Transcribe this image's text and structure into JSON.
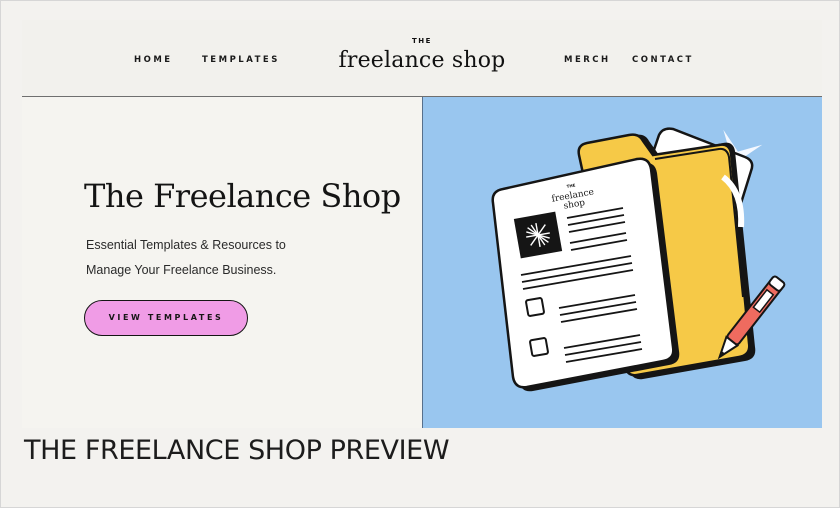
{
  "nav": {
    "home": "HOME",
    "templates": "TEMPLATES",
    "merch": "MERCH",
    "contact": "CONTACT"
  },
  "logo": {
    "small": "THE",
    "big": "freelance shop"
  },
  "hero": {
    "title": "The Freelance Shop",
    "subtitle_line1": "Essential Templates & Resources to",
    "subtitle_line2": "Manage Your Freelance Business.",
    "cta_label": "VIEW TEMPLATES"
  },
  "illustration": {
    "doc_logo_small": "THE",
    "doc_logo_line1": "freelance",
    "doc_logo_line2": "shop"
  },
  "caption": "THE FREELANCE SHOP PREVIEW",
  "colors": {
    "background": "#f3f2ef",
    "illustration_bg": "#99c6ef",
    "cta_pink": "#f09ce6",
    "folder_yellow": "#f6c947",
    "pen_red": "#ef6b5f"
  }
}
